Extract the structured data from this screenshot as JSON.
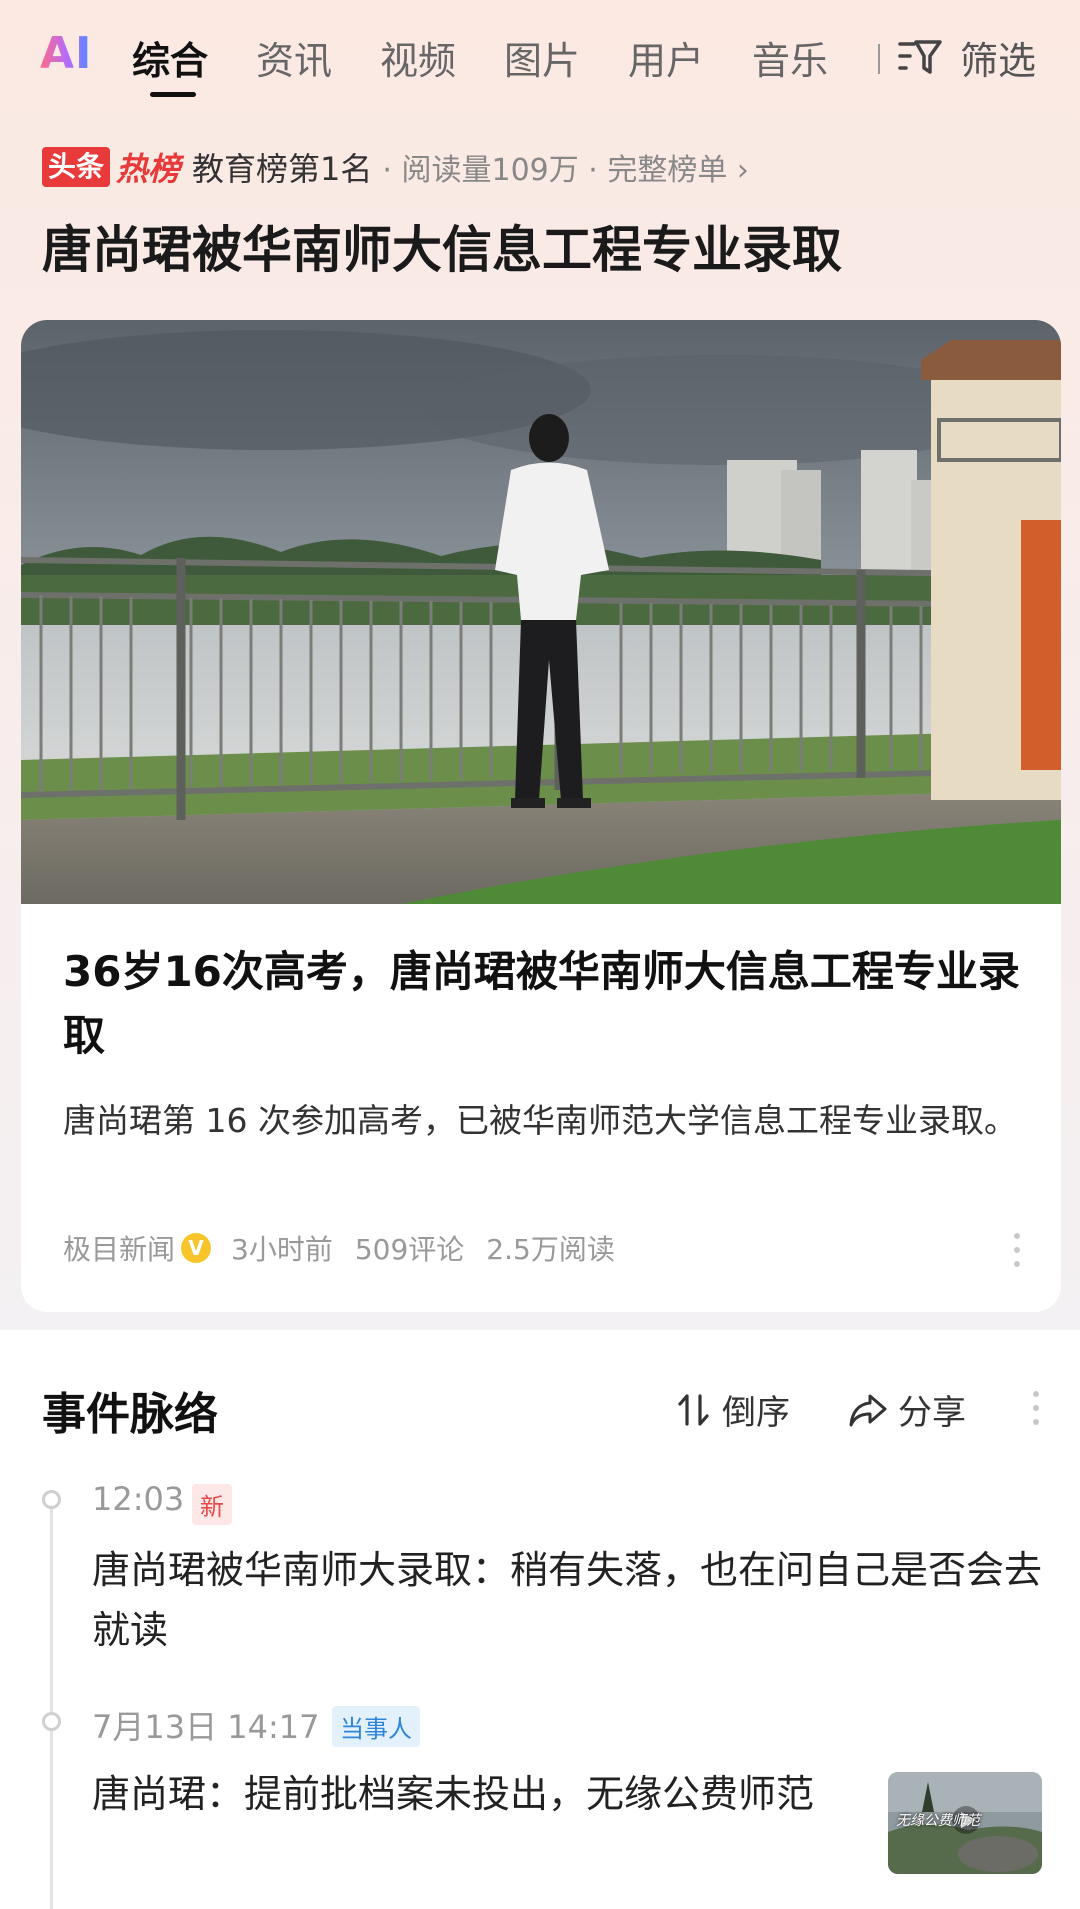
{
  "tabs": {
    "logo": "AI",
    "items": [
      "综合",
      "资讯",
      "视频",
      "图片",
      "用户",
      "音乐"
    ],
    "filter_label": "筛选"
  },
  "hot": {
    "badge_toutiao": "头条",
    "badge_hot": "热榜",
    "rank": "教育榜第1名",
    "meta": "· 阅读量109万 · 完整榜单 ›"
  },
  "headline": "唐尚珺被华南师大信息工程专业录取",
  "card": {
    "title": "36岁16次高考，唐尚珺被华南师大信息工程专业录取",
    "summary": "唐尚珺第 16 次参加高考，已被华南师范大学信息工程专业录取。",
    "source": "极目新闻",
    "verified_mark": "V",
    "time": "3小时前",
    "comments": "509评论",
    "reads": "2.5万阅读"
  },
  "timeline": {
    "title": "事件脉络",
    "sort_label": "倒序",
    "share_label": "分享",
    "events": [
      {
        "time": "12:03",
        "tag": "新",
        "text": "唐尚珺被华南师大录取：稍有失落，也在问自己是否会去就读"
      },
      {
        "time": "7月13日 14:17",
        "tag": "当事人",
        "text": "唐尚珺：提前批档案未投出，无缘公费师范",
        "thumb_caption": "无缘公费师范"
      }
    ]
  },
  "colors": {
    "accent_red": "#e83a3a",
    "verified_yellow": "#f7c52b",
    "tag_blue": "#2f86d6"
  }
}
